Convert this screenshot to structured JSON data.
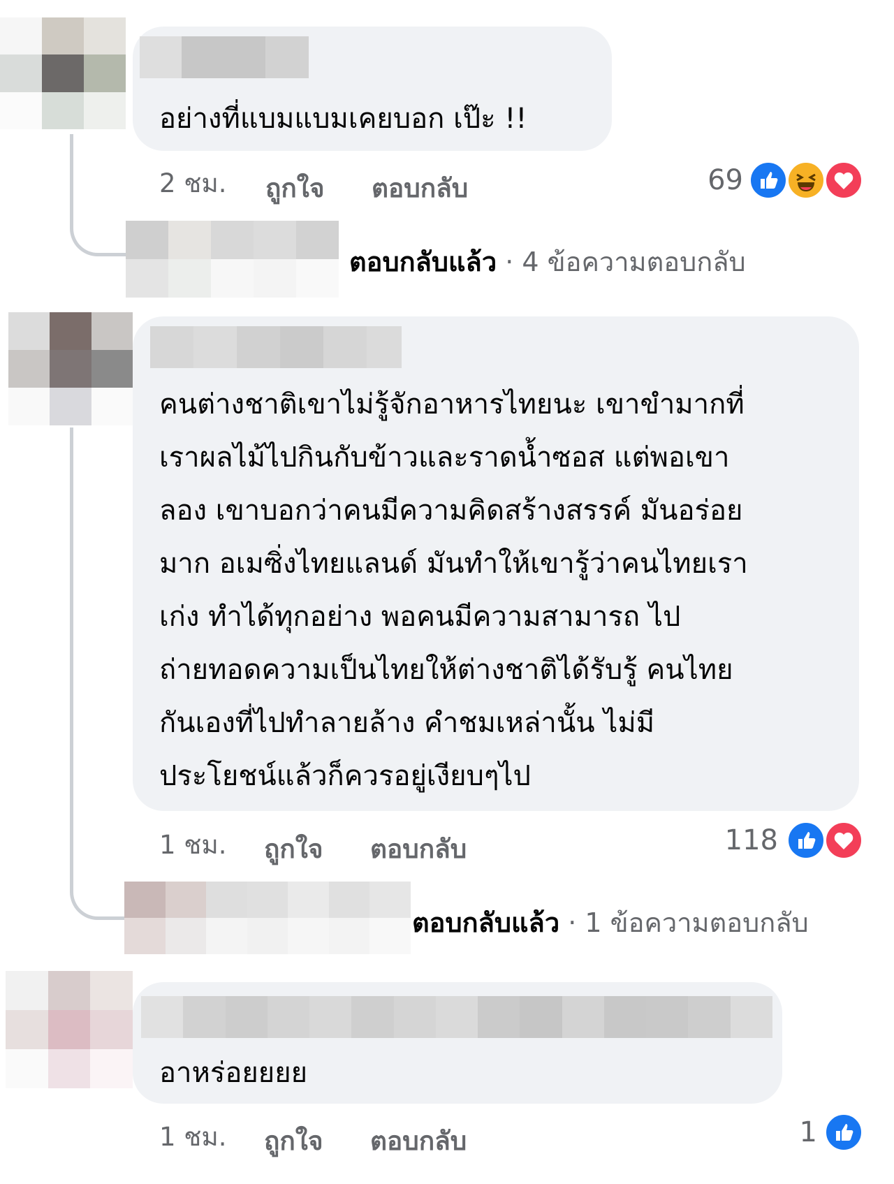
{
  "comments": [
    {
      "text": "อย่างที่แบมแบมเคยบอก เป๊ะ !!",
      "time": "2 ชม.",
      "like_label": "ถูกใจ",
      "reply_label": "ตอบกลับ",
      "reaction_count": "69",
      "reactions": [
        "like-icon",
        "haha-icon",
        "love-icon"
      ],
      "replies": {
        "replied_label": "ตอบกลับแล้ว",
        "separator": " · ",
        "count_label": "4 ข้อความตอบกลับ"
      }
    },
    {
      "text": "คนต่างชาติเขาไม่รู้จักอาหารไทยนะ เขาขำมากที่\nเราผลไม้ไปกินกับข้าวและราดน้ำซอส แต่พอเขา\nลอง เขาบอกว่าคนมีความคิดสร้างสรรค์ มันอร่อย\nมาก อเมซิ่งไทยแลนด์ มันทำให้เขารู้ว่าคนไทยเรา\nเก่ง ทำได้ทุกอย่าง พอคนมีความสามารถ ไป\nถ่ายทอดความเป็นไทยให้ต่างชาติได้รับรู้ คนไทย\nกันเองที่ไปทำลายล้าง คำชมเหล่านั้น ไม่มี\nประโยชน์แล้วก็ควรอยู่เงียบๆไป",
      "time": "1 ชม.",
      "like_label": "ถูกใจ",
      "reply_label": "ตอบกลับ",
      "reaction_count": "118",
      "reactions": [
        "like-icon",
        "love-icon"
      ],
      "replies": {
        "replied_label": "ตอบกลับแล้ว",
        "separator": " · ",
        "count_label": "1 ข้อความตอบกลับ"
      }
    },
    {
      "text": "อาหร่อยยยย",
      "time": "1 ชม.",
      "like_label": "ถูกใจ",
      "reply_label": "ตอบกลับ",
      "reaction_count": "1",
      "reactions": [
        "like-icon"
      ]
    }
  ],
  "colors": {
    "bubble": "#f0f2f5",
    "meta_text": "#65676b",
    "like_blue": "#1877f2",
    "love_red": "#f33e58",
    "haha_yellow": "#f7b125"
  }
}
